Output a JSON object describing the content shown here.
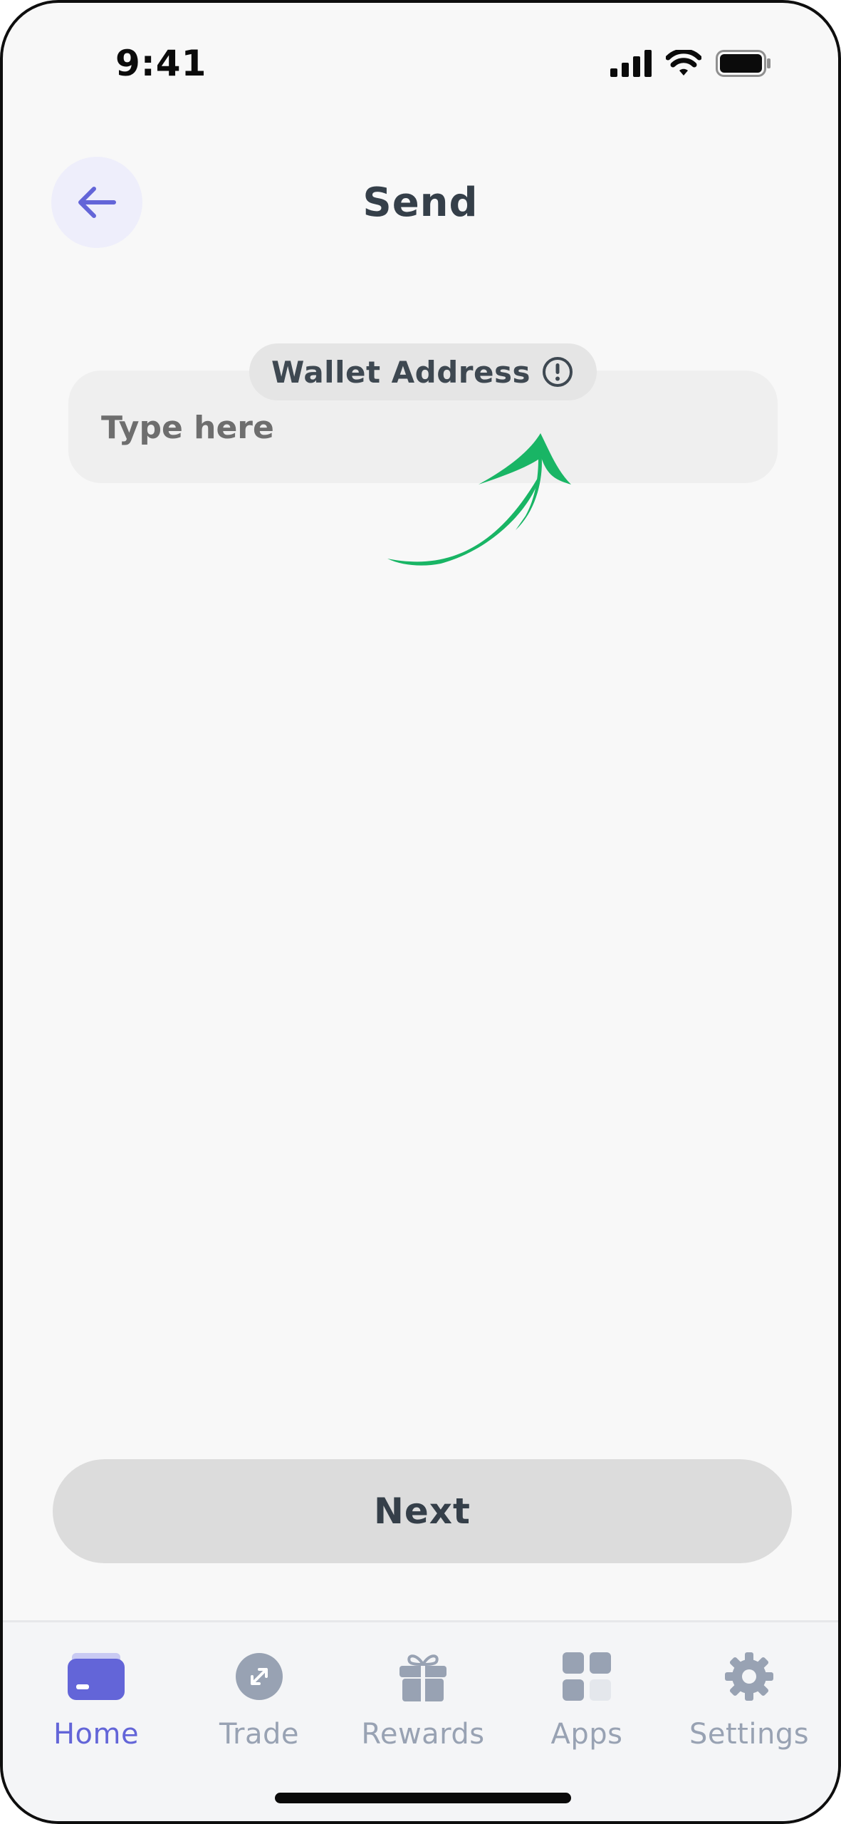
{
  "status_bar": {
    "time": "9:41",
    "icons": [
      "cellular-signal-icon",
      "wifi-icon",
      "battery-icon"
    ]
  },
  "header": {
    "title": "Send",
    "back_icon": "arrow-left-icon"
  },
  "wallet_input": {
    "label": "Wallet Address",
    "placeholder": "Type here",
    "value": "",
    "info_icon": "exclamation-circle-icon"
  },
  "annotation": {
    "icon": "curved-arrow-icon",
    "color": "#19b565"
  },
  "next_button": {
    "label": "Next"
  },
  "tab_bar": {
    "active_color": "#6365d8",
    "inactive_color": "#98a2b3",
    "items": [
      {
        "label": "Home",
        "icon": "wallet-card-icon",
        "active": true
      },
      {
        "label": "Trade",
        "icon": "trade-arrows-icon",
        "active": false
      },
      {
        "label": "Rewards",
        "icon": "gift-icon",
        "active": false
      },
      {
        "label": "Apps",
        "icon": "apps-grid-icon",
        "active": false
      },
      {
        "label": "Settings",
        "icon": "gear-icon",
        "active": false
      }
    ]
  },
  "colors": {
    "background": "#f8f8f8",
    "title": "#353f49",
    "accent": "#6365d8",
    "button_disabled": "#dcdcdc"
  }
}
